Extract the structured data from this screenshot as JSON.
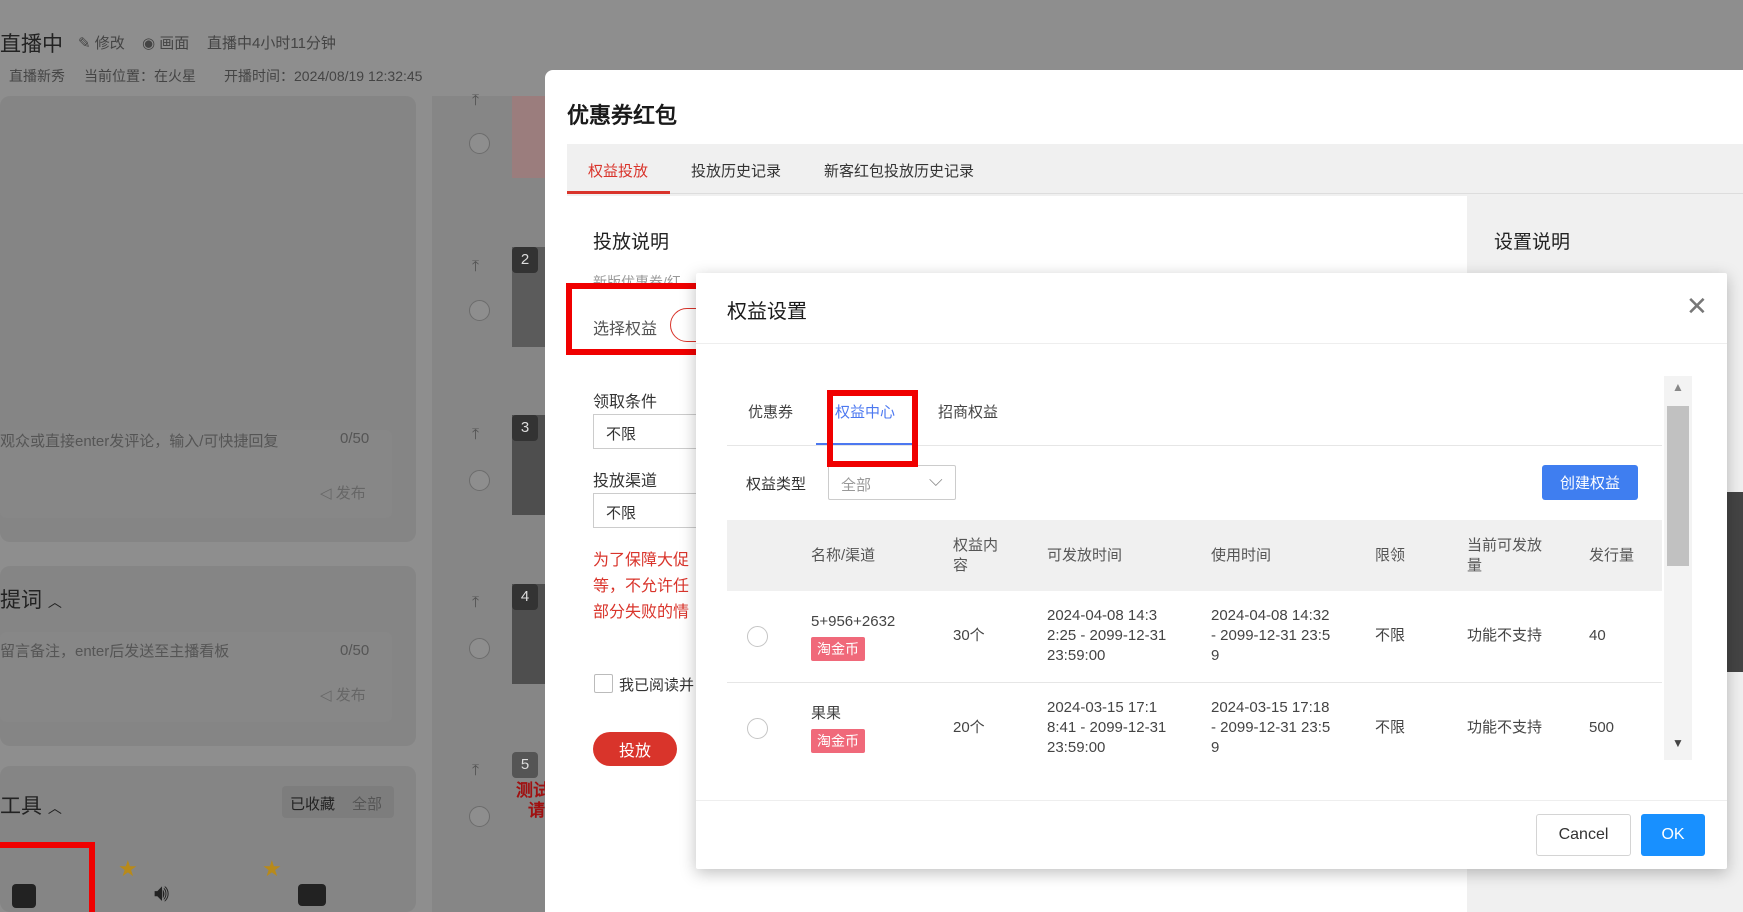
{
  "header": {
    "title": "直播中",
    "edit": "修改",
    "view": "画面",
    "duration": "直播中4小时11分钟",
    "meta_left": "直播新秀",
    "location": "当前位置：在火星",
    "start_time": "开播时间：2024/08/19 12:32:45"
  },
  "comment": {
    "placeholder": "观众或直接enter发评论，输入/可快捷回复",
    "count": "0/50",
    "publish": "发布"
  },
  "prompt": {
    "title": "提词",
    "placeholder": "留言备注，enter后发送至主播看板",
    "count": "0/50",
    "publish": "发布"
  },
  "tools": {
    "title": "工具",
    "collected": "已收藏",
    "all": "全部"
  },
  "list": {
    "numbers": [
      "2",
      "3",
      "4",
      "5"
    ],
    "test_text": "测试",
    "test_text2": "请"
  },
  "coupon_modal": {
    "title": "优惠券红包",
    "tabs": [
      "权益投放",
      "投放历史记录",
      "新客红包投放历史记录"
    ],
    "section_title": "投放说明",
    "section_desc": "新版优惠券/红",
    "select_label": "选择权益",
    "condition_label": "领取条件",
    "condition_value": "不限",
    "channel_label": "投放渠道",
    "channel_value": "不限",
    "warning_lines": [
      "为了保障大促",
      "等，不允许任",
      "部分失败的情"
    ],
    "agree": "我已阅读并",
    "submit": "投放",
    "right_title": "设置说明"
  },
  "benefit_modal": {
    "title": "权益设置",
    "tabs": [
      "优惠券",
      "权益中心",
      "招商权益"
    ],
    "active_tab": "权益中心",
    "filter_label": "权益类型",
    "filter_value": "全部",
    "create_button": "创建权益",
    "columns": [
      "名称/渠道",
      "权益内容",
      "可发放时间",
      "使用时间",
      "限领",
      "当前可发放量",
      "发行量"
    ],
    "rows": [
      {
        "name": "5+956+2632",
        "tag": "淘金币",
        "content": "30个",
        "issue_time": "2024-04-08 14:32:25 - 2099-12-31 23:59:00",
        "use_time": "2024-04-08 14:32 - 2099-12-31 23:59",
        "limit": "不限",
        "available": "功能不支持",
        "total": "40"
      },
      {
        "name": "果果",
        "tag": "淘金币",
        "content": "20个",
        "issue_time": "2024-03-15 17:18:41 - 2099-12-31 23:59:00",
        "use_time": "2024-03-15 17:18 - 2099-12-31 23:59",
        "limit": "不限",
        "available": "功能不支持",
        "total": "500"
      }
    ],
    "cancel": "Cancel",
    "ok": "OK"
  },
  "colors": {
    "accent_red": "#d9342b",
    "primary_blue": "#1890ff",
    "tab_blue": "#4c78f0",
    "tag_pink": "#f0697a",
    "annotation_red": "#f00000"
  }
}
